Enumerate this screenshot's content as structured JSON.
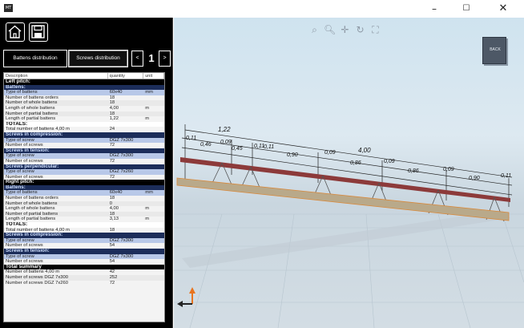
{
  "window": {
    "app_icon_text": "MT",
    "minimize": "–",
    "maximize": "☐",
    "close": "✕"
  },
  "tabs": {
    "battens": "Battens distribution",
    "screws": "Screws distribution",
    "page": "1",
    "prev": "<",
    "next": ">"
  },
  "table": {
    "headers": [
      "Description",
      "quantity",
      "unit"
    ],
    "rows": [
      {
        "type": "section",
        "desc": "Left pitch:",
        "qty": "",
        "unit": ""
      },
      {
        "type": "sub",
        "desc": "Battens:",
        "qty": "",
        "unit": ""
      },
      {
        "type": "hl",
        "desc": "Type of battens",
        "qty": "60x40",
        "unit": "mm"
      },
      {
        "type": "row",
        "desc": "Number of battens orders",
        "qty": "18",
        "unit": ""
      },
      {
        "type": "alt",
        "desc": "Number of whole battens",
        "qty": "18",
        "unit": ""
      },
      {
        "type": "row",
        "desc": "Length of whole battens",
        "qty": "4,00",
        "unit": "m"
      },
      {
        "type": "alt",
        "desc": "Number of partial battens",
        "qty": "18",
        "unit": ""
      },
      {
        "type": "row",
        "desc": "Length of partial battens",
        "qty": "1,22",
        "unit": "m"
      },
      {
        "type": "total",
        "desc": "TOTALS:",
        "qty": "",
        "unit": ""
      },
      {
        "type": "row",
        "desc": "Total number of battens 4,00 m",
        "qty": "24",
        "unit": ""
      },
      {
        "type": "sub",
        "desc": "Screws in compression:",
        "qty": "",
        "unit": ""
      },
      {
        "type": "hl",
        "desc": "Type of screw",
        "qty": "DGZ 7x300",
        "unit": ""
      },
      {
        "type": "row",
        "desc": "Number of screws",
        "qty": "72",
        "unit": ""
      },
      {
        "type": "sub",
        "desc": "Screws in tension:",
        "qty": "",
        "unit": ""
      },
      {
        "type": "hl",
        "desc": "Type of screw",
        "qty": "DGZ 7x300",
        "unit": ""
      },
      {
        "type": "row",
        "desc": "Number of screws",
        "qty": "72",
        "unit": ""
      },
      {
        "type": "sub",
        "desc": "Screws perpendicular:",
        "qty": "",
        "unit": ""
      },
      {
        "type": "hl",
        "desc": "Type of screw",
        "qty": "DGZ 7x260",
        "unit": ""
      },
      {
        "type": "row",
        "desc": "Number of screws",
        "qty": "72",
        "unit": ""
      },
      {
        "type": "section",
        "desc": "Right pitch:",
        "qty": "",
        "unit": ""
      },
      {
        "type": "sub",
        "desc": "Battens:",
        "qty": "",
        "unit": ""
      },
      {
        "type": "hl",
        "desc": "Type of battens",
        "qty": "60x40",
        "unit": "mm"
      },
      {
        "type": "row",
        "desc": "Number of battens orders",
        "qty": "18",
        "unit": ""
      },
      {
        "type": "alt",
        "desc": "Number of whole battens",
        "qty": "0",
        "unit": ""
      },
      {
        "type": "row",
        "desc": "Length of whole battens",
        "qty": "4,00",
        "unit": "m"
      },
      {
        "type": "alt",
        "desc": "Number of partial battens",
        "qty": "18",
        "unit": ""
      },
      {
        "type": "row",
        "desc": "Length of partial battens",
        "qty": "3,13",
        "unit": "m"
      },
      {
        "type": "total",
        "desc": "TOTALS:",
        "qty": "",
        "unit": ""
      },
      {
        "type": "row",
        "desc": "Total number of battens 4,00 m",
        "qty": "18",
        "unit": ""
      },
      {
        "type": "sub",
        "desc": "Screws in compression:",
        "qty": "",
        "unit": ""
      },
      {
        "type": "hl",
        "desc": "Type of screw",
        "qty": "DGZ 7x300",
        "unit": ""
      },
      {
        "type": "row",
        "desc": "Number of screws",
        "qty": "54",
        "unit": ""
      },
      {
        "type": "sub",
        "desc": "Screws in tension:",
        "qty": "",
        "unit": ""
      },
      {
        "type": "hl",
        "desc": "Type of screw",
        "qty": "DGZ 7x300",
        "unit": ""
      },
      {
        "type": "row",
        "desc": "Number of screws",
        "qty": "54",
        "unit": ""
      },
      {
        "type": "section",
        "desc": "Total summary",
        "qty": "",
        "unit": ""
      },
      {
        "type": "row",
        "desc": "Number of battens 4,00 m",
        "qty": "42",
        "unit": ""
      },
      {
        "type": "alt",
        "desc": "Number of screws DGZ 7x300",
        "qty": "252",
        "unit": ""
      },
      {
        "type": "row",
        "desc": "Number of screws DGZ 7x260",
        "qty": "72",
        "unit": ""
      }
    ]
  },
  "viewport": {
    "back_label": "BACK",
    "tools": [
      "zoom-window-icon",
      "zoom-icon",
      "pan-icon",
      "rotate-icon",
      "fit-icon"
    ],
    "dimensions": {
      "top_row": [
        "1,22",
        "4,00"
      ],
      "labels": [
        "0,11",
        "0,46",
        "0,09",
        "0,45",
        "0,11",
        "0,11",
        "0,90",
        "0,09",
        "0,86",
        "0,09",
        "0,86",
        "0,09",
        "0,90",
        "0,11"
      ]
    },
    "colors": {
      "batten": "#b9a98a",
      "batten_edge": "#d9893b",
      "screw_rail": "#8c3a3a",
      "axis_vertical": "#e8741f",
      "axis_horizontal": "#222222"
    }
  }
}
